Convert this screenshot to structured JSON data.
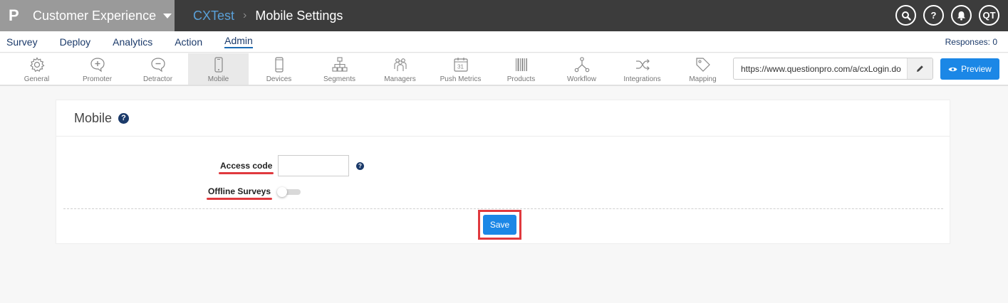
{
  "app": {
    "logo": "P",
    "product": "Customer Experience"
  },
  "breadcrumb": {
    "parent": "CXTest",
    "separator": "›",
    "current": "Mobile Settings"
  },
  "top_icons": {
    "search": "🔍",
    "help": "?",
    "notifications": "🔔",
    "user_initials": "QT"
  },
  "nav": {
    "items": [
      "Survey",
      "Deploy",
      "Analytics",
      "Action",
      "Admin"
    ],
    "active": "Admin",
    "responses": "Responses: 0"
  },
  "toolbar": {
    "tools": [
      "General",
      "Promoter",
      "Detractor",
      "Mobile",
      "Devices",
      "Segments",
      "Managers",
      "Push Metrics",
      "Products",
      "Workflow",
      "Integrations",
      "Mapping"
    ],
    "active": "Mobile",
    "url": "https://www.questionpro.com/a/cxLogin.do",
    "preview_label": "Preview"
  },
  "card": {
    "title": "Mobile",
    "help": "?",
    "access_code_label": "Access code",
    "access_code_value": "",
    "offline_surveys_label": "Offline Surveys",
    "offline_surveys_enabled": false,
    "save_label": "Save"
  },
  "colors": {
    "accent": "#1b87e6",
    "highlight": "#e0393e",
    "topbar": "#3c3c3c",
    "brand_bg": "#9a9a9a"
  }
}
